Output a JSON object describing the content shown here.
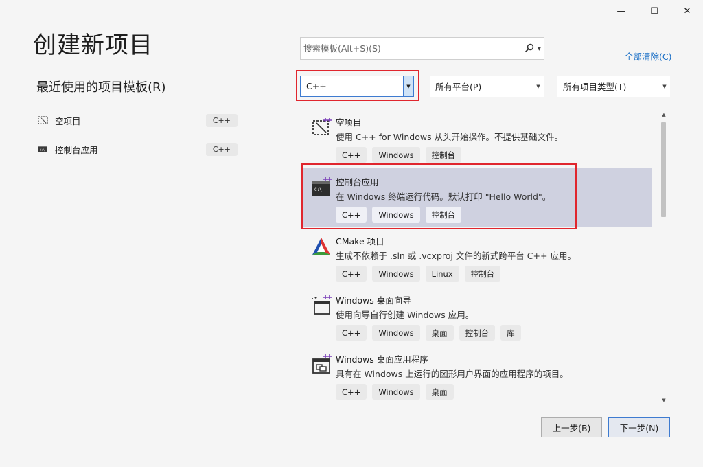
{
  "window": {
    "minimize_glyph": "—",
    "maximize_glyph": "☐",
    "close_glyph": "✕"
  },
  "page_title": "创建新项目",
  "recent": {
    "title": "最近使用的项目模板(R)",
    "items": [
      {
        "icon": "empty-project-icon",
        "label": "空项目",
        "tag": "C++"
      },
      {
        "icon": "console-app-icon",
        "label": "控制台应用",
        "tag": "C++"
      }
    ]
  },
  "search": {
    "placeholder": "搜索模板(Alt+S)(S)",
    "value": ""
  },
  "clear_all": "全部清除(C)",
  "filters": {
    "language": "C++",
    "platform": "所有平台(P)",
    "project_type": "所有项目类型(T)"
  },
  "templates": [
    {
      "icon": "empty-project-icon",
      "name": "空项目",
      "description": "使用 C++ for Windows 从头开始操作。不提供基础文件。",
      "tags": [
        "C++",
        "Windows",
        "控制台"
      ],
      "selected": false
    },
    {
      "icon": "console-app-icon",
      "name": "控制台应用",
      "description": "在 Windows 终端运行代码。默认打印 \"Hello World\"。",
      "tags": [
        "C++",
        "Windows",
        "控制台"
      ],
      "selected": true
    },
    {
      "icon": "cmake-icon",
      "name": "CMake 项目",
      "description": "生成不依赖于 .sln 或 .vcxproj 文件的新式跨平台 C++ 应用。",
      "tags": [
        "C++",
        "Windows",
        "Linux",
        "控制台"
      ],
      "selected": false
    },
    {
      "icon": "desktop-wizard-icon",
      "name": "Windows 桌面向导",
      "description": "使用向导自行创建 Windows 应用。",
      "tags": [
        "C++",
        "Windows",
        "桌面",
        "控制台",
        "库"
      ],
      "selected": false
    },
    {
      "icon": "desktop-app-icon",
      "name": "Windows 桌面应用程序",
      "description": "具有在 Windows 上运行的图形用户界面的应用程序的项目。",
      "tags": [
        "C++",
        "Windows",
        "桌面"
      ],
      "selected": false
    }
  ],
  "buttons": {
    "back": "上一步(B)",
    "next": "下一步(N)"
  },
  "colors": {
    "highlight_border": "#e0262e",
    "link": "#1a6fc6",
    "selection": "#cfd1e0"
  }
}
